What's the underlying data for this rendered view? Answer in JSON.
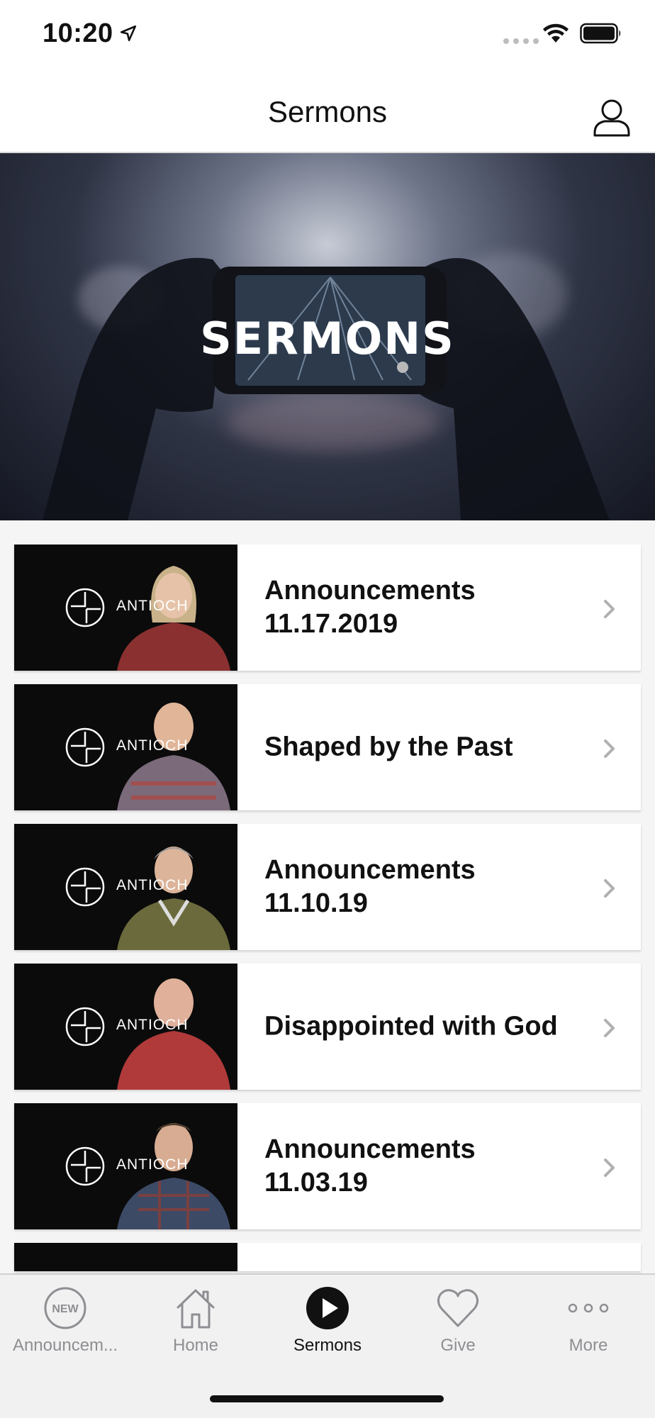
{
  "status_bar": {
    "time": "10:20"
  },
  "header": {
    "title": "Sermons"
  },
  "hero": {
    "title": "SERMONS"
  },
  "sermons": [
    {
      "title": "Announcements 11.17.2019",
      "brand": "ANTIOCH"
    },
    {
      "title": "Shaped by the Past",
      "brand": "ANTIOCH"
    },
    {
      "title": "Announcements 11.10.19",
      "brand": "ANTIOCH"
    },
    {
      "title": "Disappointed with God",
      "brand": "ANTIOCH"
    },
    {
      "title": "Announcements 11.03.19",
      "brand": "ANTIOCH"
    }
  ],
  "tabs": [
    {
      "label": "Announcem...",
      "icon": "new-badge-icon",
      "badge": "NEW"
    },
    {
      "label": "Home",
      "icon": "home-icon"
    },
    {
      "label": "Sermons",
      "icon": "play-circle-icon",
      "active": true
    },
    {
      "label": "Give",
      "icon": "heart-icon"
    },
    {
      "label": "More",
      "icon": "more-dots-icon"
    }
  ],
  "colors": {
    "accent": "#111111",
    "inactive": "#8e8e93",
    "tab_bg": "#f1f1f1"
  }
}
